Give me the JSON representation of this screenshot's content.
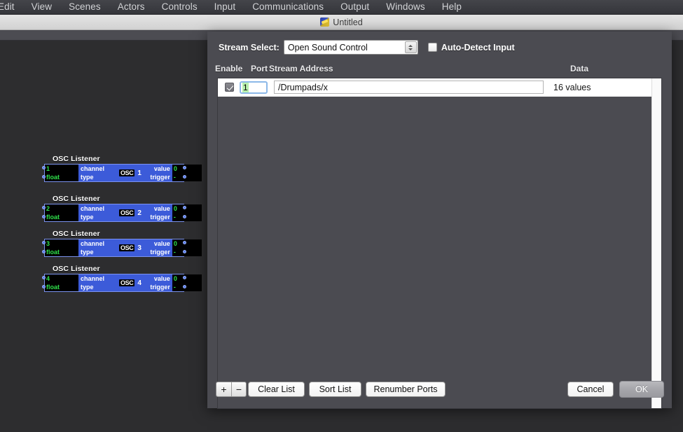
{
  "menubar": {
    "items": [
      {
        "label": "Edit"
      },
      {
        "label": "View"
      },
      {
        "label": "Scenes"
      },
      {
        "label": "Actors"
      },
      {
        "label": "Controls"
      },
      {
        "label": "Input"
      },
      {
        "label": "Communications"
      },
      {
        "label": "Output"
      },
      {
        "label": "Windows"
      },
      {
        "label": "Help"
      }
    ]
  },
  "window": {
    "title": "Untitled",
    "icon": "document-icon"
  },
  "canvas": {
    "nodes": [
      {
        "title": "OSC Listener",
        "channel_value": "1",
        "channel_label": "channel",
        "type_value": "float",
        "type_label": "type",
        "badge": "OSC",
        "number": "1",
        "value_label": "value",
        "value_value": "0",
        "trigger_label": "trigger",
        "trigger_value": "-"
      },
      {
        "title": "OSC Listener",
        "channel_value": "2",
        "channel_label": "channel",
        "type_value": "float",
        "type_label": "type",
        "badge": "OSC",
        "number": "2",
        "value_label": "value",
        "value_value": "0",
        "trigger_label": "trigger",
        "trigger_value": "-"
      },
      {
        "title": "OSC Listener",
        "channel_value": "3",
        "channel_label": "channel",
        "type_value": "float",
        "type_label": "type",
        "badge": "OSC",
        "number": "3",
        "value_label": "value",
        "value_value": "0",
        "trigger_label": "trigger",
        "trigger_value": "-"
      },
      {
        "title": "OSC Listener",
        "channel_value": "4",
        "channel_label": "channel",
        "type_value": "float",
        "type_label": "type",
        "badge": "OSC",
        "number": "4",
        "value_label": "value",
        "value_value": "0",
        "trigger_label": "trigger",
        "trigger_value": "-"
      }
    ]
  },
  "dialog": {
    "stream_select_label": "Stream Select:",
    "stream_select_value": "Open Sound Control",
    "stream_select_options": [
      "Open Sound Control"
    ],
    "auto_detect_label": "Auto-Detect Input",
    "auto_detect_checked": false,
    "columns": {
      "enable": "Enable",
      "port": "Port",
      "address": "Stream Address",
      "data": "Data"
    },
    "rows": [
      {
        "enabled": true,
        "port": "1",
        "address": "/Drumpads/x",
        "data": "16 values"
      }
    ],
    "buttons": {
      "add": "+",
      "remove": "−",
      "clear_list": "Clear List",
      "sort_list": "Sort List",
      "renumber_ports": "Renumber Ports",
      "cancel": "Cancel",
      "ok": "OK"
    }
  },
  "colors": {
    "node_blue": "#3c5bd9",
    "node_green_text": "#2fe04a",
    "selection_green": "#b8f0ae",
    "focus_blue": "#8cb8e8",
    "dialog_gray": "#4b4b51"
  }
}
